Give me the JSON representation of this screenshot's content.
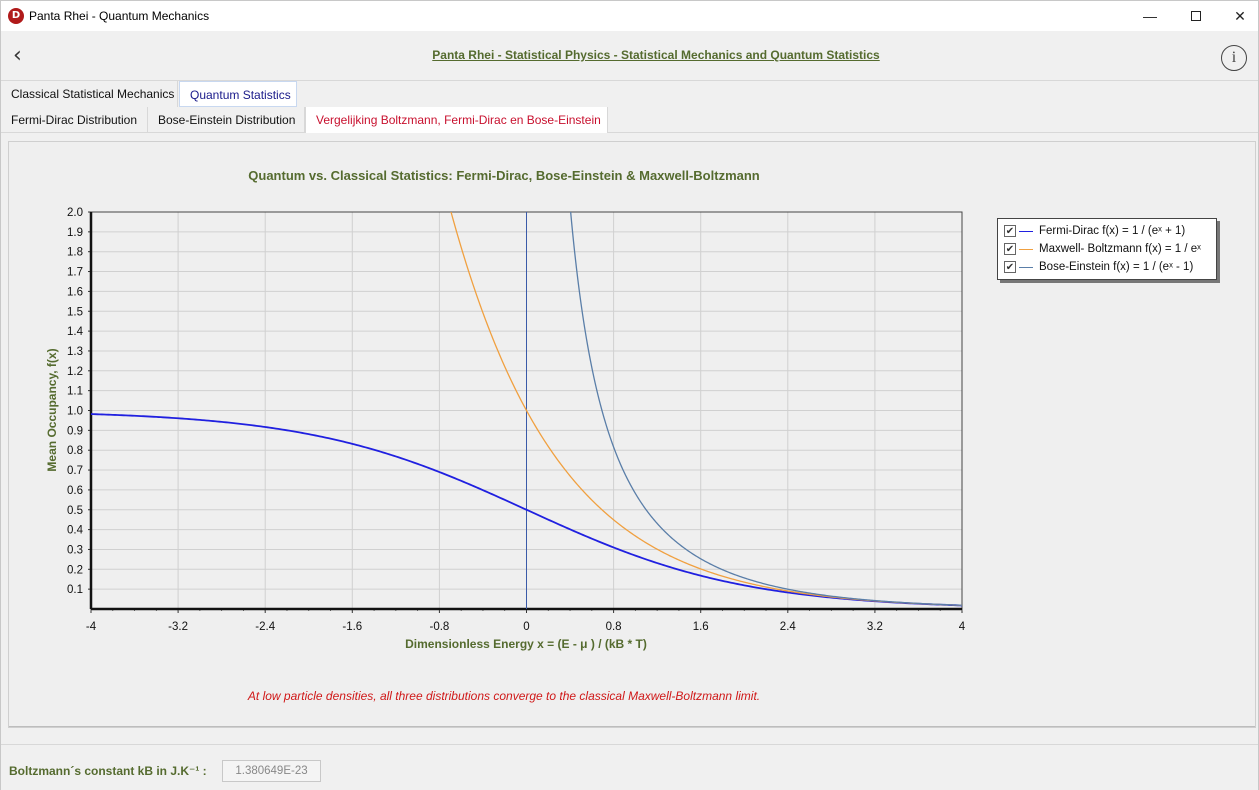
{
  "window": {
    "app_icon_letter": "D",
    "title": "Panta Rhei - Quantum Mechanics",
    "minimize_glyph": "—",
    "close_glyph": "✕"
  },
  "header": {
    "back_glyph": "‹",
    "title": "Panta Rhei - Statistical Physics - Statistical Mechanics and Quantum Statistics",
    "info_glyph": "i"
  },
  "tabs_level1": [
    {
      "label": "Classical Statistical Mechanics"
    },
    {
      "label": "Quantum Statistics"
    }
  ],
  "tabs_level2": [
    {
      "label": "Fermi-Dirac Distribution"
    },
    {
      "label": "Bose-Einstein Distribution"
    },
    {
      "label": "Vergelijking Boltzmann, Fermi-Dirac en Bose-Einstein"
    }
  ],
  "legend": [
    {
      "check": "✔",
      "label": "Fermi-Dirac f(x) = 1 / (eˣ + 1)"
    },
    {
      "check": "✔",
      "label": "Maxwell- Boltzmann f(x) = 1 / eˣ"
    },
    {
      "check": "✔",
      "label": "Bose-Einstein f(x) = 1 / (eˣ - 1)"
    }
  ],
  "footnote": "At low particle densities, all three distributions converge to the classical Maxwell-Boltzmann limit.",
  "bottom": {
    "kb_label": "Boltzmann´s constant kB in J.K⁻¹ :",
    "kb_value": "1.380649E-23"
  },
  "colors": {
    "title_green": "#556b2f",
    "fermi_dirac": "#2020e0",
    "maxwell_boltzmann": "#f0a040",
    "bose_einstein": "#5a7ea8",
    "footnote_red": "#d01818"
  },
  "chart_data": {
    "type": "line",
    "title": "Quantum vs. Classical Statistics: Fermi-Dirac, Bose-Einstein & Maxwell-Boltzmann",
    "xlabel": "Dimensionless Energy  x = (E - μ ) / (kB * T)",
    "ylabel": "Mean Occupancy, f(x)",
    "xlim": [
      -4,
      4
    ],
    "ylim": [
      0,
      2.0
    ],
    "x_ticks": [
      "-4",
      "-3.2",
      "-2.4",
      "-1.6",
      "-0.8",
      "0",
      "0.8",
      "1.6",
      "2.4",
      "3.2",
      "4"
    ],
    "y_ticks": [
      "0.1",
      "0.2",
      "0.3",
      "0.4",
      "0.5",
      "0.6",
      "0.7",
      "0.8",
      "0.9",
      "1.0",
      "1.1",
      "1.2",
      "1.3",
      "1.4",
      "1.5",
      "1.6",
      "1.7",
      "1.8",
      "1.9",
      "2.0"
    ],
    "grid": true,
    "legend_position": "top-right outside",
    "series": [
      {
        "name": "Fermi-Dirac f(x) = 1 / (eˣ + 1)",
        "x": [
          -4,
          -3.2,
          -2.4,
          -1.6,
          -0.8,
          0,
          0.8,
          1.6,
          2.4,
          3.2,
          4
        ],
        "values": [
          0.98,
          0.96,
          0.92,
          0.83,
          0.69,
          0.5,
          0.31,
          0.17,
          0.08,
          0.04,
          0.02
        ]
      },
      {
        "name": "Maxwell- Boltzmann f(x) = 1 / eˣ",
        "x": [
          -0.69,
          -0.4,
          -0.2,
          0,
          0.4,
          0.8,
          1.2,
          1.6,
          2.4,
          3.2,
          4
        ],
        "values": [
          2.0,
          1.49,
          1.22,
          1.0,
          0.67,
          0.45,
          0.3,
          0.2,
          0.09,
          0.04,
          0.02
        ]
      },
      {
        "name": "Bose-Einstein f(x) = 1 / (eˣ - 1)",
        "x": [
          0.41,
          0.6,
          0.8,
          1.2,
          1.6,
          2.4,
          3.2,
          4
        ],
        "values": [
          2.0,
          1.22,
          0.81,
          0.43,
          0.25,
          0.1,
          0.04,
          0.02
        ]
      }
    ]
  }
}
